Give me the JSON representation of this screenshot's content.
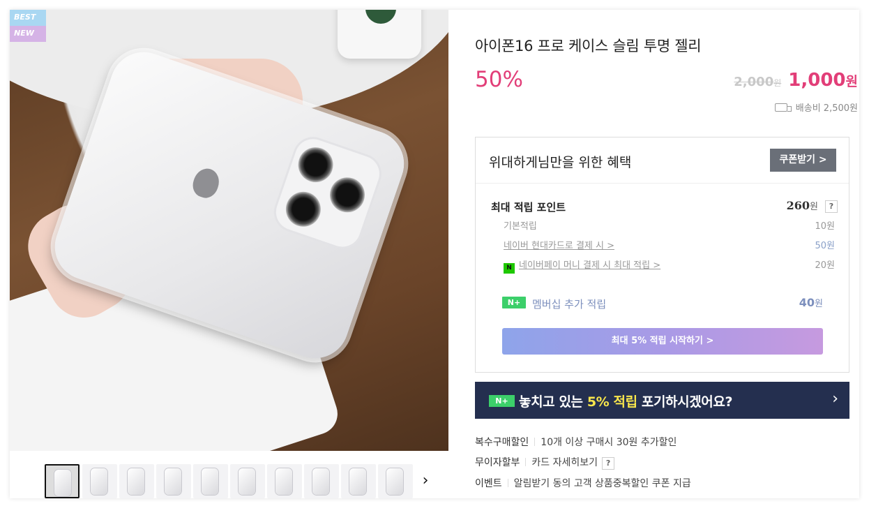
{
  "badges": {
    "best": "BEST",
    "new": "NEW"
  },
  "product": {
    "title": "아이폰16 프로 케이스 슬림 투명 젤리",
    "discount": "50%",
    "original_price": "2,000",
    "original_unit": "원",
    "sale_price": "1,000",
    "sale_unit": "원",
    "shipping": "배송비 2,500원"
  },
  "benefit": {
    "title": "위대하게님만을 위한 혜택",
    "coupon_button": "쿠폰받기 >",
    "points_title": "최대 적립 포인트",
    "points_total": "260",
    "points_unit": "원",
    "help": "?",
    "rows": [
      {
        "label": "기본적립",
        "value": "10원"
      },
      {
        "label": "네이버 현대카드로 결제 시 >",
        "value": "50원"
      },
      {
        "label": "네이버페이 머니 결제 시 최대 적립 >",
        "value": "20원"
      }
    ],
    "membership_label": "멤버십 추가 적립",
    "membership_value": "40",
    "membership_unit": "원",
    "nplus_icon_text": "N+",
    "npay_icon_text": "N",
    "start_button": "최대 5% 적립 시작하기 >"
  },
  "promo": {
    "icon_text": "N+",
    "text_before": "놓치고 있는 ",
    "text_highlight": "5% 적립",
    "text_after": " 포기하시겠어요?",
    "arrow": "›"
  },
  "info": {
    "bulk_key": "복수구매할인",
    "bulk_value": "10개 이상 구매시 30원 추가할인",
    "installment_key": "무이자할부",
    "installment_value": "카드 자세히보기",
    "event_key": "이벤트",
    "event_value": "알림받기 동의 고객 상품중복할인 쿠폰 지급"
  },
  "thumbnails": {
    "next_arrow": "›",
    "count": 10
  },
  "colors": {
    "accent_pink": "#e23e78",
    "promo_navy": "#242f4f",
    "coupon_gray": "#6a6f78",
    "member_blue": "#7c8fbd"
  }
}
